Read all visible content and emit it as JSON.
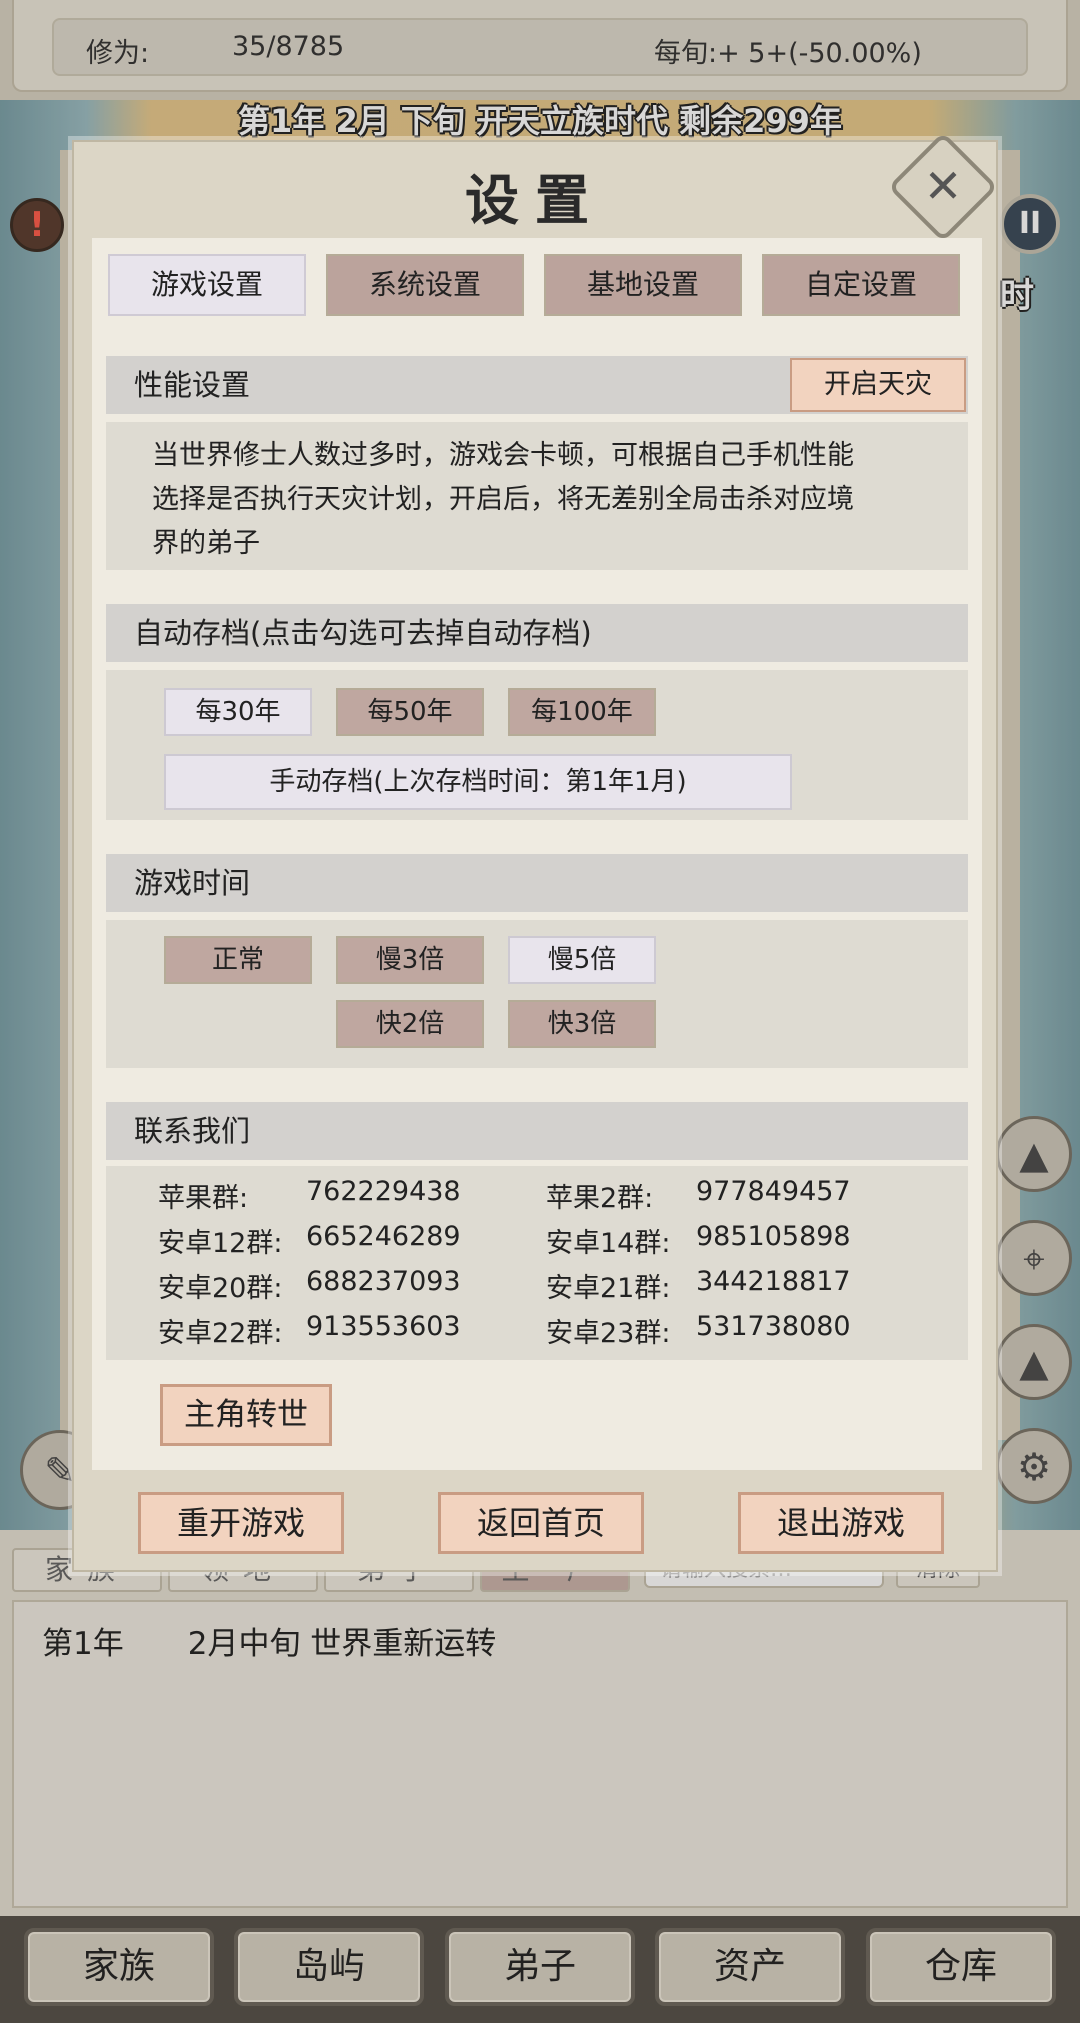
{
  "status": {
    "cultivation_label": "修为:",
    "cultivation_value": "35/8785",
    "per_tick": "每旬:+ 5+(-50.00%)"
  },
  "date_banner": "第1年 2月 下旬  开天立族时代 剩余299年",
  "side": {
    "time_char": "时"
  },
  "mini_tabs": [
    "家族",
    "领地",
    "弟子",
    "王 厂"
  ],
  "mini_search_placeholder": "请输入搜索…",
  "mini_clear": "清除",
  "log": {
    "year": "第1年",
    "text": "2月中旬 世界重新运转"
  },
  "bottom_nav": [
    "家族",
    "岛屿",
    "弟子",
    "资产",
    "仓库"
  ],
  "dialog": {
    "title": "设置",
    "tabs": [
      "游戏设置",
      "系统设置",
      "基地设置",
      "自定设置"
    ],
    "performance": {
      "title": "性能设置",
      "button": "开启天灾",
      "desc_lines": [
        "当世界修士人数过多时，游戏会卡顿，可根据自己手机性能",
        "选择是否执行天灾计划，开启后，将无差别全局击杀对应境",
        "界的弟子"
      ]
    },
    "autosave": {
      "title": "自动存档(点击勾选可去掉自动存档)",
      "options": [
        "每30年",
        "每50年",
        "每100年"
      ],
      "manual": "手动存档(上次存档时间：第1年1月)"
    },
    "game_time": {
      "title": "游戏时间",
      "options": [
        "正常",
        "慢3倍",
        "慢5倍",
        "快2倍",
        "快3倍"
      ]
    },
    "contact": {
      "title": "联系我们",
      "groups": [
        {
          "label": "苹果群:",
          "number": "762229438"
        },
        {
          "label": "苹果2群:",
          "number": "977849457"
        },
        {
          "label": "安卓12群:",
          "number": "665246289"
        },
        {
          "label": "安卓14群:",
          "number": "985105898"
        },
        {
          "label": "安卓20群:",
          "number": "688237093"
        },
        {
          "label": "安卓21群:",
          "number": "344218817"
        },
        {
          "label": "安卓22群:",
          "number": "913553603"
        },
        {
          "label": "安卓23群:",
          "number": "531738080"
        }
      ]
    },
    "reincarnate": "主角转世",
    "footer": [
      "重开游戏",
      "返回首页",
      "退出游戏"
    ]
  },
  "colors": {
    "tab_active": "#e8e4ec",
    "tab_inactive": "#bba39c",
    "button_orange": "#f2d3bf",
    "section_header": "#d3d1ce"
  },
  "icons": [
    "warning-icon",
    "pause-icon",
    "close-icon",
    "mountain-icon",
    "map-pin-icon",
    "gear-icon",
    "brush-icon"
  ]
}
